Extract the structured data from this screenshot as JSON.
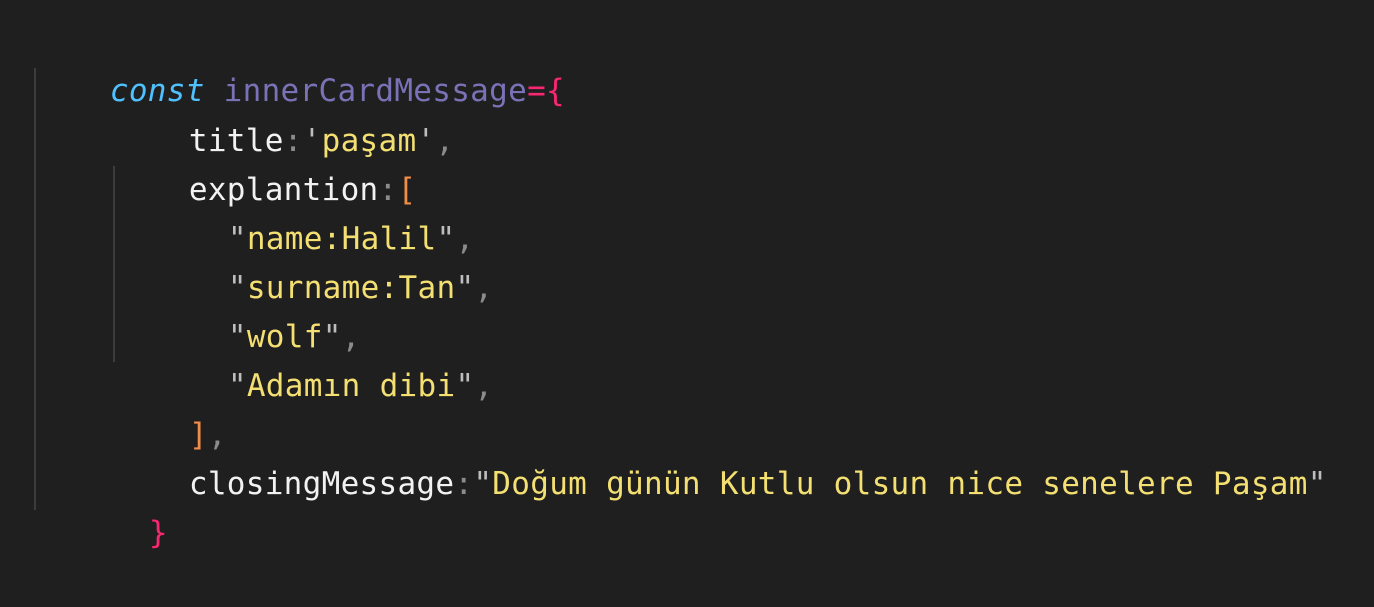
{
  "code": {
    "line1": {
      "keyword": "const",
      "name": "innerCardMessage",
      "operator": "=",
      "brace": "{"
    },
    "line2": {
      "prop": "title",
      "colon": ":",
      "quote_open": "'",
      "value": "paşam",
      "quote_close": "'",
      "comma": ","
    },
    "line3": {
      "prop": "explantion",
      "colon": ":",
      "bracket": "["
    },
    "array_items": [
      {
        "quote_open": "\"",
        "value": "name:Halil",
        "quote_close": "\"",
        "comma": ","
      },
      {
        "quote_open": "\"",
        "value": "surname:Tan",
        "quote_close": "\"",
        "comma": ","
      },
      {
        "quote_open": "\"",
        "value": "wolf",
        "quote_close": "\"",
        "comma": ","
      },
      {
        "quote_open": "\"",
        "value": "Adamın dibi",
        "quote_close": "\"",
        "comma": ","
      }
    ],
    "line8": {
      "bracket": "]",
      "comma": ","
    },
    "line9": {
      "prop": "closingMessage",
      "colon": ":",
      "quote_open": "\"",
      "value": "Doğum günün Kutlu olsun nice senelere Paşam",
      "quote_close": "\""
    },
    "line10": {
      "brace": "}"
    }
  }
}
